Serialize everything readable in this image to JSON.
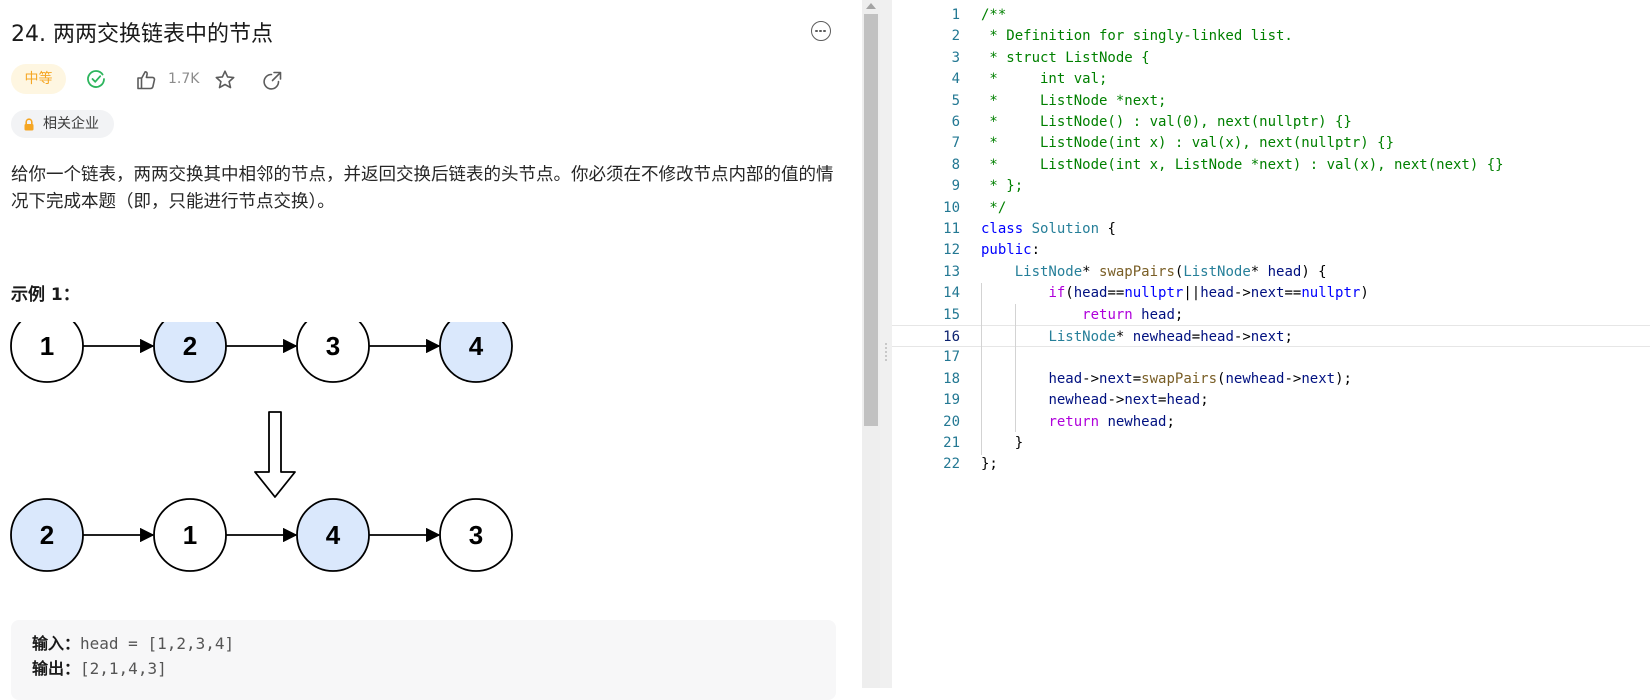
{
  "problem": {
    "title": "24. 两两交换链表中的节点",
    "difficulty": "中等",
    "likes": "1.7K",
    "company_tag": "相关企业",
    "description": "给你一个链表，两两交换其中相邻的节点，并返回交换后链表的头节点。你必须在不修改节点内部的值的情况下完成本题（即，只能进行节点交换）。",
    "example_title": "示例 1：",
    "diagram": {
      "before": [
        "1",
        "2",
        "3",
        "4"
      ],
      "after": [
        "2",
        "1",
        "4",
        "3"
      ]
    },
    "example": {
      "input_label": "输入：",
      "input_value": "head = [1,2,3,4]",
      "output_label": "输出：",
      "output_value": "[2,1,4,3]"
    }
  },
  "icons": [
    "more-icon",
    "solved-check-icon",
    "thumbs-up-icon",
    "star-icon",
    "share-icon",
    "lock-icon"
  ],
  "colors": {
    "difficulty_medium": "#f5a623",
    "solved": "#2db55d",
    "highlight_node": "#dae8fc"
  },
  "editor": {
    "active_line": 16,
    "lines": [
      "/**",
      " * Definition for singly-linked list.",
      " * struct ListNode {",
      " *     int val;",
      " *     ListNode *next;",
      " *     ListNode() : val(0), next(nullptr) {}",
      " *     ListNode(int x) : val(x), next(nullptr) {}",
      " *     ListNode(int x, ListNode *next) : val(x), next(next) {}",
      " * };",
      " */",
      "class Solution {",
      "public:",
      "    ListNode* swapPairs(ListNode* head) {",
      "        if(head==nullptr||head->next==nullptr)",
      "            return head;",
      "        ListNode* newhead=head->next;",
      "",
      "        head->next=swapPairs(newhead->next);",
      "        newhead->next=head;",
      "        return newhead;",
      "    }",
      "};"
    ]
  }
}
